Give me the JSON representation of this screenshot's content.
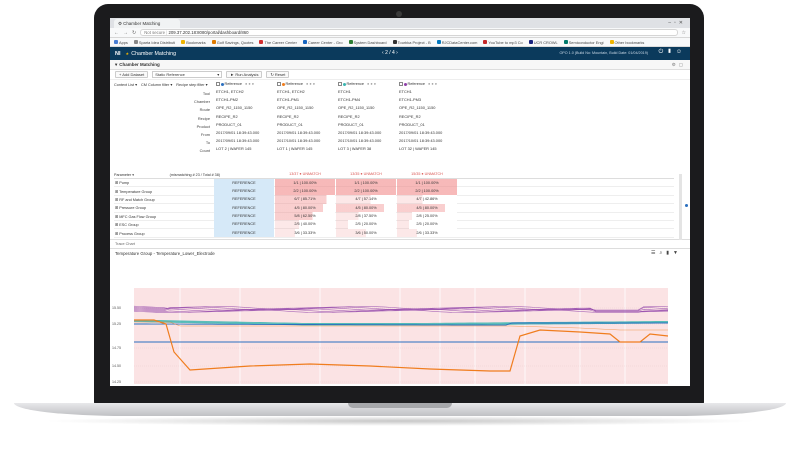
{
  "browser": {
    "tab_title": "Chamber Matching",
    "address_security": "Not secure",
    "address_url": "209.37.202.18:8080/portal/dashboard/860",
    "bookmarks": [
      {
        "label": "Apps",
        "color": "#4a7fd4"
      },
      {
        "label": "Sparta Idea Distributi",
        "color": "#888888"
      },
      {
        "label": "Bookmarks",
        "color": "#f0b400"
      },
      {
        "label": "Golf Savings, Quotes",
        "color": "#e07b00"
      },
      {
        "label": "The Career Center",
        "color": "#d32f2f"
      },
      {
        "label": "Career Center - Gro",
        "color": "#1565c0"
      },
      {
        "label": "System Dashboard",
        "color": "#2e7d32"
      },
      {
        "label": "Tourbka Project - B",
        "color": "#333333"
      },
      {
        "label": "RJCDataCenter.com",
        "color": "#0277bd"
      },
      {
        "label": "YouTube to mp3 Co",
        "color": "#c62828"
      },
      {
        "label": "UCR CROWL",
        "color": "#1a237e"
      },
      {
        "label": "Semiconductor Engi",
        "color": "#00796b"
      },
      {
        "label": "Other bookmarks",
        "color": "#f0b400"
      }
    ]
  },
  "app": {
    "logo": "NI",
    "title": "Chamber Matching",
    "pager": "2 / 4",
    "info": "OPO 1.0 (Build No: Mountain, Build Date: 01/04/2019)"
  },
  "panel": {
    "title": "Chamber Matching"
  },
  "toolbar": {
    "add_dataset": "+ Add Dataset",
    "reference_select": "Static Reference",
    "run_analysis": "► Run Analysis",
    "reset": "↻ Reset"
  },
  "context": {
    "context_list": "Context List ▾",
    "cm_column_filter": "CM Column filter ▾",
    "recipe_step_filter": "Recipe step filter ▾"
  },
  "row_labels": [
    "Tool",
    "Chamber",
    "Route",
    "Recipe",
    "Product",
    "From",
    "To",
    "Count"
  ],
  "columns": [
    {
      "header": "Reference",
      "dot": "#2a6fbf",
      "values": [
        "ETCH1, ETCH2",
        "ETCH1-PM2",
        "OPE_R2_1150_1150",
        "RECIPE_R2",
        "PRODUCT_01",
        "2017/09/01 18:39:43.000",
        "2017/09/01 18:39:43.000",
        "LOT 2 | WAFER 145"
      ]
    },
    {
      "header": "Reference",
      "dot": "#f07d1e",
      "values": [
        "ETCH1, ETCH2",
        "ETCH1-PM1",
        "OPE_R2_1150_1150",
        "RECIPE_R2",
        "PRODUCT_01",
        "2017/09/01 18:39:43.000",
        "2017/10/01 18:39:43.000",
        "LOT 1 | WAFER 145"
      ]
    },
    {
      "header": "Reference",
      "dot": "#3ab5b0",
      "values": [
        "ETCH1",
        "ETCH1-PM4",
        "OPE_R2_1150_1150",
        "RECIPE_R2",
        "PRODUCT_01",
        "2017/09/01 18:39:43.000",
        "2017/10/01 18:39:43.000",
        "LOT 3 | WAFER 38"
      ]
    },
    {
      "header": "Reference",
      "dot": "#8e3fa8",
      "values": [
        "ETCH1",
        "ETCH1-PM3",
        "OPE_R2_1150_1150",
        "RECIPE_R2",
        "PRODUCT_01",
        "2017/09/01 18:39:43.000",
        "2017/10/01 18:39:43.000",
        "LOT 32 | WAFER 145"
      ]
    }
  ],
  "param_header": {
    "label": "Parameter ▾",
    "count": "(mismatching # 23 / Total # 38)",
    "col_status": [
      "",
      "13/37 ● UNMATCH",
      "13/35 ● UNMATCH",
      "15/35 ● UNMATCH"
    ]
  },
  "groups": [
    {
      "name": "⊞ Pump",
      "cells": [
        "REFERENCE",
        "1/1 | 100.00%",
        "1/1 | 100.00%",
        "1/1 | 100.00%"
      ]
    },
    {
      "name": "⊞ Temperature Group",
      "cells": [
        "REFERENCE",
        "2/2 | 100.00%",
        "2/2 | 100.00%",
        "2/2 | 100.00%"
      ]
    },
    {
      "name": "⊞ RF and Match Group",
      "cells": [
        "REFERENCE",
        "6/7 | 85.71%",
        "4/7 | 57.14%",
        "4/7 | 42.86%"
      ]
    },
    {
      "name": "⊞ Pressure Group",
      "cells": [
        "REFERENCE",
        "4/5 | 80.00%",
        "4/5 | 80.00%",
        "4/5 | 80.00%"
      ]
    },
    {
      "name": "⊞ MFC Gas Flow Group",
      "cells": [
        "REFERENCE",
        "5/8 | 62.50%",
        "2/8 | 37.50%",
        "2/8 | 25.00%"
      ]
    },
    {
      "name": "⊞ ESC Group",
      "cells": [
        "REFERENCE",
        "2/5 | 40.00%",
        "2/5 | 20.00%",
        "2/5 | 20.00%"
      ]
    },
    {
      "name": "⊞ Process Group",
      "cells": [
        "REFERENCE",
        "3/6 | 33.33%",
        "3/6 | 50.00%",
        "2/6 | 33.33%"
      ]
    }
  ],
  "trace_label": "Trace Chart",
  "chart_title": "Temperature Group - Temperature_Lower_Electrode",
  "chart_data": {
    "type": "line",
    "y_ticks": [
      "15.50",
      "15.25",
      "14.75",
      "14.50",
      "14.25"
    ],
    "series": [
      {
        "color": "#8e3fa8"
      },
      {
        "color": "#3ab5b0"
      },
      {
        "color": "#2a6fbf"
      },
      {
        "color": "#f07d1e"
      }
    ],
    "grid": true
  }
}
